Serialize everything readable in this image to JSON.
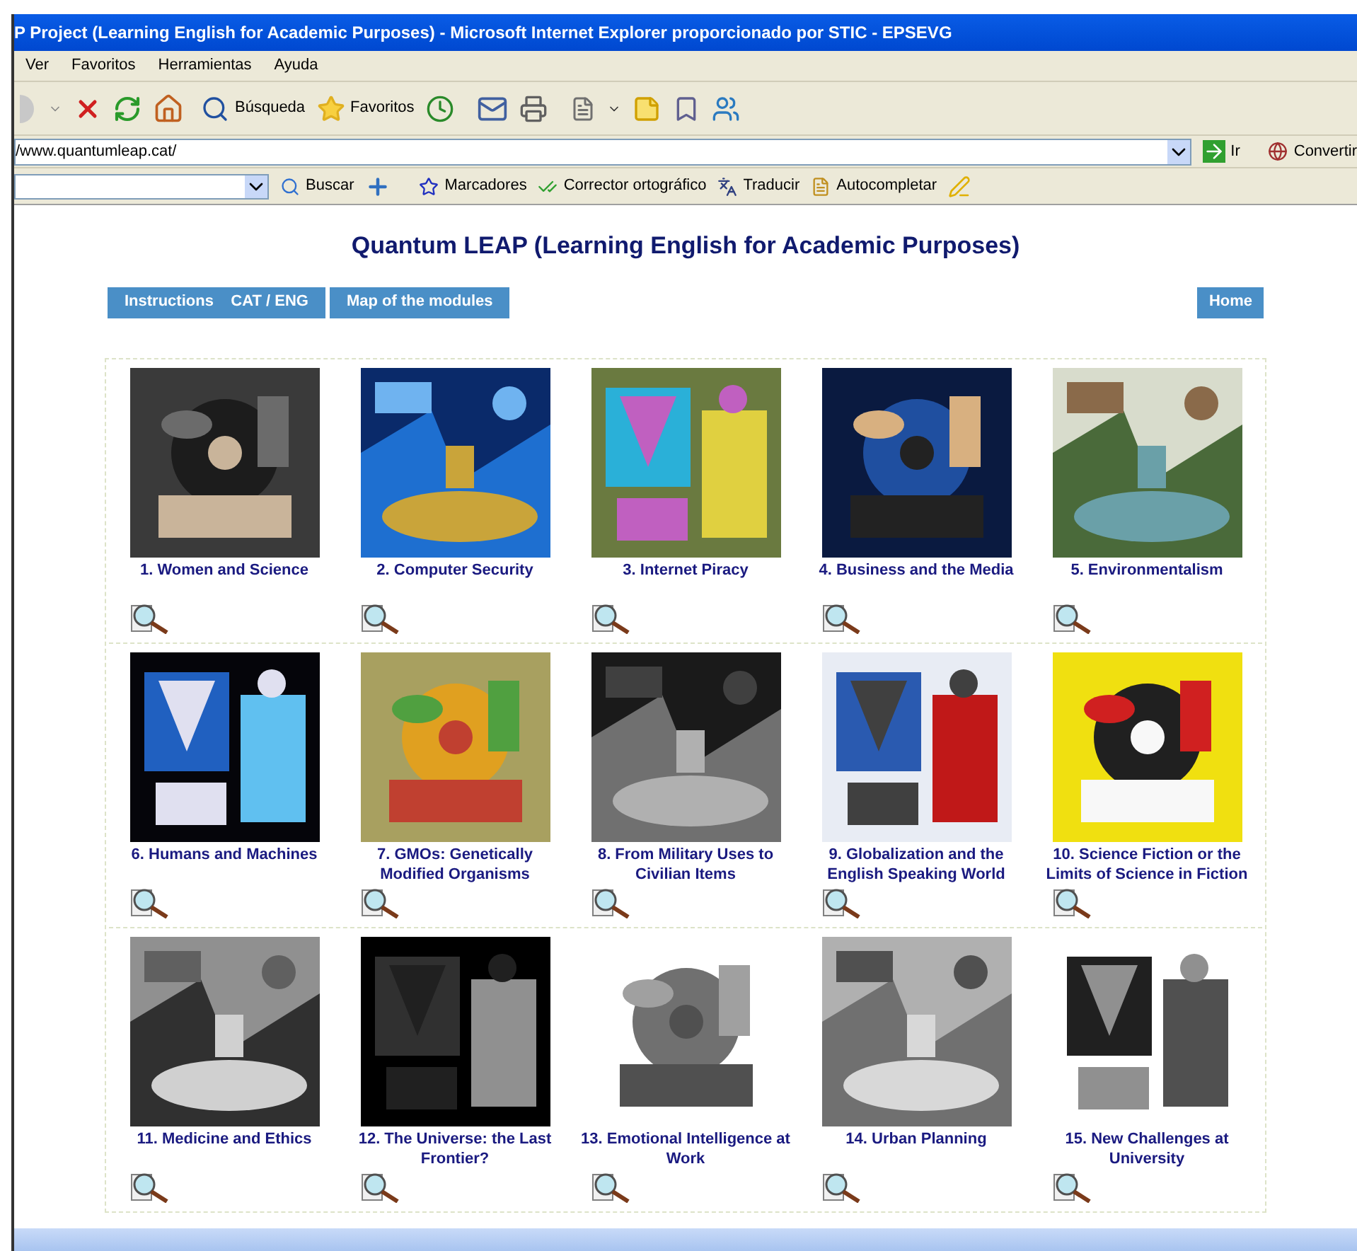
{
  "window": {
    "title": "P Project (Learning English for Academic Purposes) - Microsoft Internet Explorer proporcionado por STIC - EPSEVG"
  },
  "menu": [
    "Ver",
    "Favoritos",
    "Herramientas",
    "Ayuda"
  ],
  "toolbar": {
    "search_label": "Búsqueda",
    "favorites_label": "Favoritos"
  },
  "address": {
    "value": "/www.quantumleap.cat/",
    "go_label": "Ir",
    "convert_label": "Convertir"
  },
  "search_toolbar": {
    "search_label": "Buscar",
    "bookmarks_label": "Marcadores",
    "spellcheck_label": "Corrector ortográfico",
    "translate_label": "Traducir",
    "autofill_label": "Autocompletar"
  },
  "page": {
    "heading": "Quantum LEAP (Learning English for Academic Purposes)",
    "nav": [
      {
        "label": "Instructions",
        "extra": "CAT / ENG"
      },
      {
        "label": "Map of the modules"
      }
    ],
    "home": "Home",
    "modules": [
      {
        "title": "1. Women and Science"
      },
      {
        "title": "2. Computer Security"
      },
      {
        "title": "3. Internet Piracy"
      },
      {
        "title": "4. Business and the Media"
      },
      {
        "title": "5. Environmentalism"
      },
      {
        "title": "6. Humans and Machines"
      },
      {
        "title": "7. GMOs: Genetically Modified Organisms"
      },
      {
        "title": "8. From Military Uses to Civilian Items"
      },
      {
        "title": "9. Globalization and the English Speaking World"
      },
      {
        "title": "10. Science Fiction or the Limits of Science in Fiction"
      },
      {
        "title": "11. Medicine and Ethics"
      },
      {
        "title": "12. The Universe: the Last Frontier?"
      },
      {
        "title": "13. Emotional Intelligence at Work"
      },
      {
        "title": "14. Urban Planning"
      },
      {
        "title": "15. New Challenges at University"
      }
    ]
  }
}
